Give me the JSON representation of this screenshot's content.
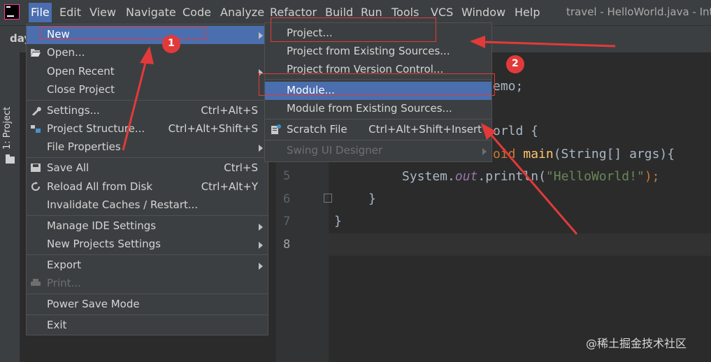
{
  "menubar": {
    "items": [
      "File",
      "Edit",
      "View",
      "Navigate",
      "Code",
      "Analyze",
      "Refactor",
      "Build",
      "Run",
      "Tools",
      "VCS",
      "Window",
      "Help"
    ],
    "title": "travel - HelloWorld.java - Inte"
  },
  "toolbar": {
    "project_prefix": "day"
  },
  "sidebar": {
    "tab_label": "1: Project"
  },
  "file_menu": [
    {
      "label": "New",
      "shortcut": "",
      "submenu": true,
      "highlighted": true
    },
    {
      "label": "Open...",
      "shortcut": "",
      "icon": "folder-open-icon"
    },
    {
      "label": "Open Recent",
      "shortcut": "",
      "submenu": true
    },
    {
      "label": "Close Project",
      "shortcut": ""
    },
    {
      "label": "Settings...",
      "shortcut": "Ctrl+Alt+S",
      "icon": "wrench-icon"
    },
    {
      "label": "Project Structure...",
      "shortcut": "Ctrl+Alt+Shift+S",
      "icon": "project-structure-icon"
    },
    {
      "label": "File Properties",
      "shortcut": "",
      "submenu": true
    },
    {
      "label": "Save All",
      "shortcut": "Ctrl+S",
      "icon": "save-icon"
    },
    {
      "label": "Reload All from Disk",
      "shortcut": "Ctrl+Alt+Y",
      "icon": "reload-icon"
    },
    {
      "label": "Invalidate Caches / Restart...",
      "shortcut": ""
    },
    {
      "label": "Manage IDE Settings",
      "shortcut": "",
      "submenu": true
    },
    {
      "label": "New Projects Settings",
      "shortcut": "",
      "submenu": true
    },
    {
      "label": "Export",
      "shortcut": "",
      "submenu": true
    },
    {
      "label": "Print...",
      "shortcut": "",
      "icon": "print-icon",
      "disabled": true
    },
    {
      "label": "Power Save Mode",
      "shortcut": ""
    },
    {
      "label": "Exit",
      "shortcut": ""
    }
  ],
  "new_submenu": [
    {
      "label": "Project...",
      "shortcut": ""
    },
    {
      "label": "Project from Existing Sources...",
      "shortcut": ""
    },
    {
      "label": "Project from Version Control...",
      "shortcut": ""
    },
    {
      "label": "Module...",
      "shortcut": "",
      "highlighted": true
    },
    {
      "label": "Module from Existing Sources...",
      "shortcut": ""
    },
    {
      "label": "Scratch File",
      "shortcut": "Ctrl+Alt+Shift+Insert",
      "icon": "scratch-file-icon"
    },
    {
      "label": "Swing UI Designer",
      "shortcut": "",
      "submenu": true,
      "disabled": true
    }
  ],
  "editor": {
    "line_numbers": [
      "5",
      "6",
      "7",
      "8"
    ],
    "current_line": "8",
    "visible_fragments": {
      "package_end": "emo;",
      "class_end": "orld {",
      "void_kw": "oid",
      "main_fn": "main",
      "args": "(String[] args){",
      "print_prefix": "System.",
      "print_field": "out",
      "print_call": ".println(",
      "print_string": "\"HelloWorld!\"",
      "print_end": ");",
      "close_method": "}",
      "close_class": "}"
    }
  },
  "annotations": {
    "badge1": "1",
    "badge2": "2",
    "accent": "#e23a3a"
  },
  "watermark": "@稀土掘金技术社区"
}
